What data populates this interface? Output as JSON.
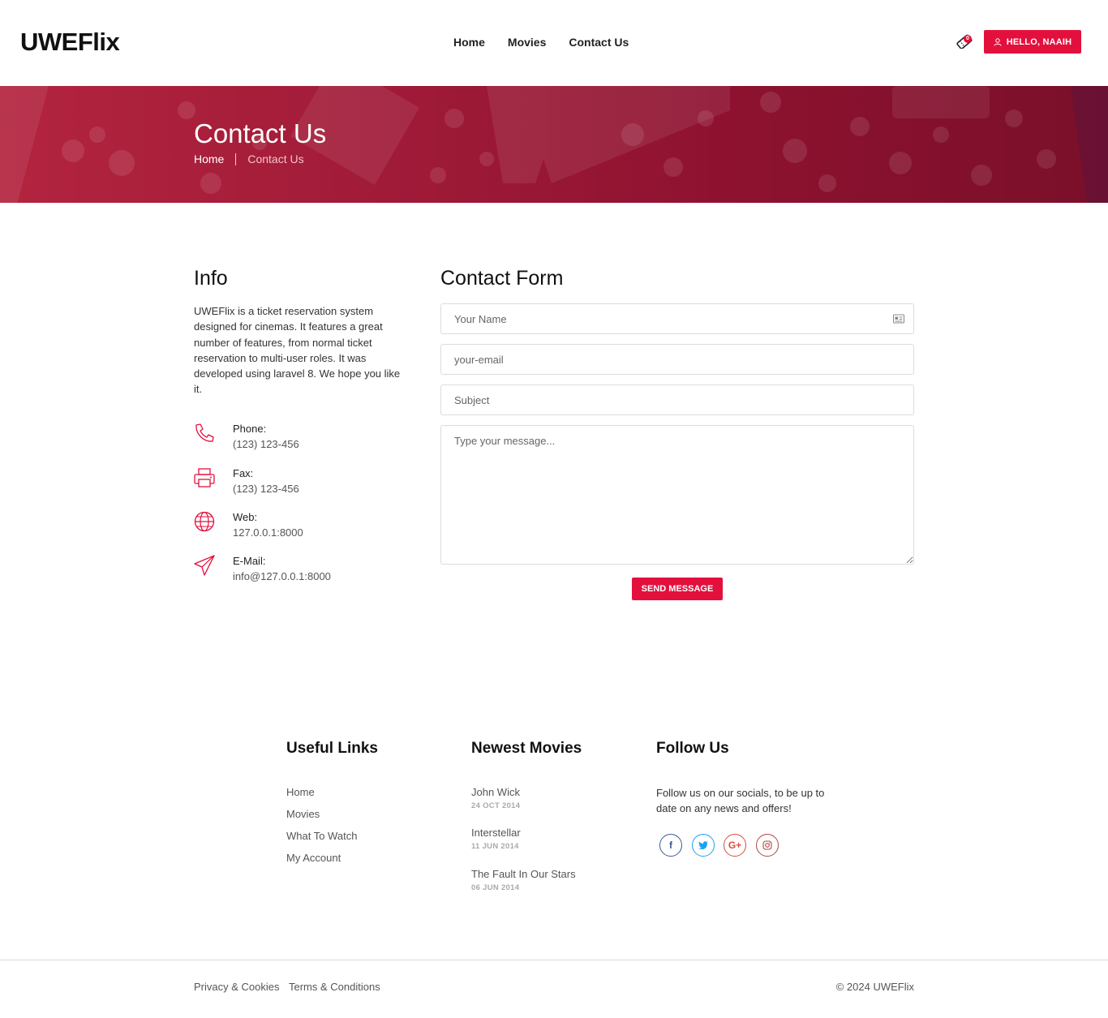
{
  "header": {
    "logo": "UWEFlix",
    "nav": [
      "Home",
      "Movies",
      "Contact Us"
    ],
    "cart_count": "0",
    "user_button": "HELLO, NAAIH"
  },
  "banner": {
    "title": "Contact Us",
    "breadcrumb": [
      "Home",
      "Contact Us"
    ]
  },
  "info": {
    "title": "Info",
    "description": "UWEFlix is a ticket reservation system designed for cinemas. It features a great number of features, from normal ticket reservation to multi-user roles. It was developed using laravel 8. We hope you like it.",
    "items": [
      {
        "icon": "phone-icon",
        "label": "Phone:",
        "value": "(123) 123-456"
      },
      {
        "icon": "printer-icon",
        "label": "Fax:",
        "value": "(123) 123-456"
      },
      {
        "icon": "globe-icon",
        "label": "Web:",
        "value": "127.0.0.1:8000"
      },
      {
        "icon": "paper-plane-icon",
        "label": "E-Mail:",
        "value": "info@127.0.0.1:8000"
      }
    ]
  },
  "form": {
    "title": "Contact Form",
    "name_placeholder": "Your Name",
    "email_placeholder": "your-email",
    "subject_placeholder": "Subject",
    "message_placeholder": "Type your message...",
    "submit_label": "SEND MESSAGE"
  },
  "footer": {
    "useful_links_title": "Useful Links",
    "useful_links": [
      "Home",
      "Movies",
      "What To Watch",
      "My Account"
    ],
    "newest_movies_title": "Newest Movies",
    "newest_movies": [
      {
        "title": "John Wick",
        "date": "24 OCT 2014"
      },
      {
        "title": "Interstellar",
        "date": "11 JUN 2014"
      },
      {
        "title": "The Fault In Our Stars",
        "date": "06 JUN 2014"
      }
    ],
    "follow_title": "Follow Us",
    "follow_text": "Follow us on our socials, to be up to date on any news and offers!",
    "socials": [
      {
        "icon": "facebook-icon",
        "glyph": "f",
        "color": "#3b5998"
      },
      {
        "icon": "twitter-icon",
        "glyph": "t",
        "color": "#1da1f2"
      },
      {
        "icon": "google-plus-icon",
        "glyph": "G+",
        "color": "#dd4b39"
      },
      {
        "icon": "instagram-icon",
        "glyph": "◎",
        "color": "#c13584"
      }
    ],
    "bottom_links": [
      "Privacy & Cookies",
      "Terms & Conditions"
    ],
    "copyright": "© 2024 UWEFlix"
  },
  "colors": {
    "accent": "#e3103d",
    "banner": "#9c1a37"
  }
}
